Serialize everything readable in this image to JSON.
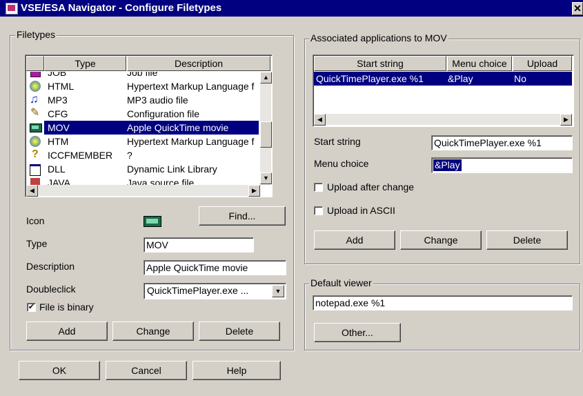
{
  "window": {
    "title": "VSE/ESA Navigator - Configure Filetypes",
    "close_label": "✕"
  },
  "filetypes": {
    "legend": "Filetypes",
    "columns": [
      "Type",
      "Description"
    ],
    "rows": [
      {
        "type": "JOB",
        "description": "Job file",
        "icon": "job-icon"
      },
      {
        "type": "HTML",
        "description": "Hypertext Markup Language f",
        "icon": "web-icon"
      },
      {
        "type": "MP3",
        "description": "MP3 audio file",
        "icon": "music-note-icon"
      },
      {
        "type": "CFG",
        "description": "Configuration file",
        "icon": "pencil-icon"
      },
      {
        "type": "MOV",
        "description": "Apple QuickTime movie",
        "icon": "film-icon",
        "selected": true
      },
      {
        "type": "HTM",
        "description": "Hypertext Markup Language f",
        "icon": "web-icon"
      },
      {
        "type": "ICCFMEMBER",
        "description": "?",
        "icon": "question-icon"
      },
      {
        "type": "DLL",
        "description": "Dynamic Link Library",
        "icon": "window-icon"
      },
      {
        "type": "JAVA",
        "description": "Java source file",
        "icon": "java-icon"
      }
    ],
    "icon_label": "Icon",
    "find_label": "Find...",
    "type_label": "Type",
    "type_value": "MOV",
    "description_label": "Description",
    "description_value": "Apple QuickTime movie",
    "doubleclick_label": "Doubleclick",
    "doubleclick_value": "QuickTimePlayer.exe ...",
    "binary_label": "File is binary",
    "binary_checked": true,
    "add_label": "Add",
    "change_label": "Change",
    "delete_label": "Delete"
  },
  "assoc": {
    "legend": "Associated applications to MOV",
    "columns": [
      "Start string",
      "Menu choice",
      "Upload"
    ],
    "rows": [
      {
        "start": "QuickTimePlayer.exe %1",
        "menu": "&Play",
        "upload": "No",
        "selected": true
      }
    ],
    "start_label": "Start string",
    "start_value": "QuickTimePlayer.exe %1",
    "menu_label": "Menu choice",
    "menu_value": "&Play",
    "upload_after_label": "Upload after change",
    "upload_ascii_label": "Upload in ASCII",
    "add_label": "Add",
    "change_label": "Change",
    "delete_label": "Delete"
  },
  "viewer": {
    "legend": "Default viewer",
    "value": "notepad.exe %1",
    "other_label": "Other..."
  },
  "footer": {
    "ok_label": "OK",
    "cancel_label": "Cancel",
    "help_label": "Help"
  }
}
